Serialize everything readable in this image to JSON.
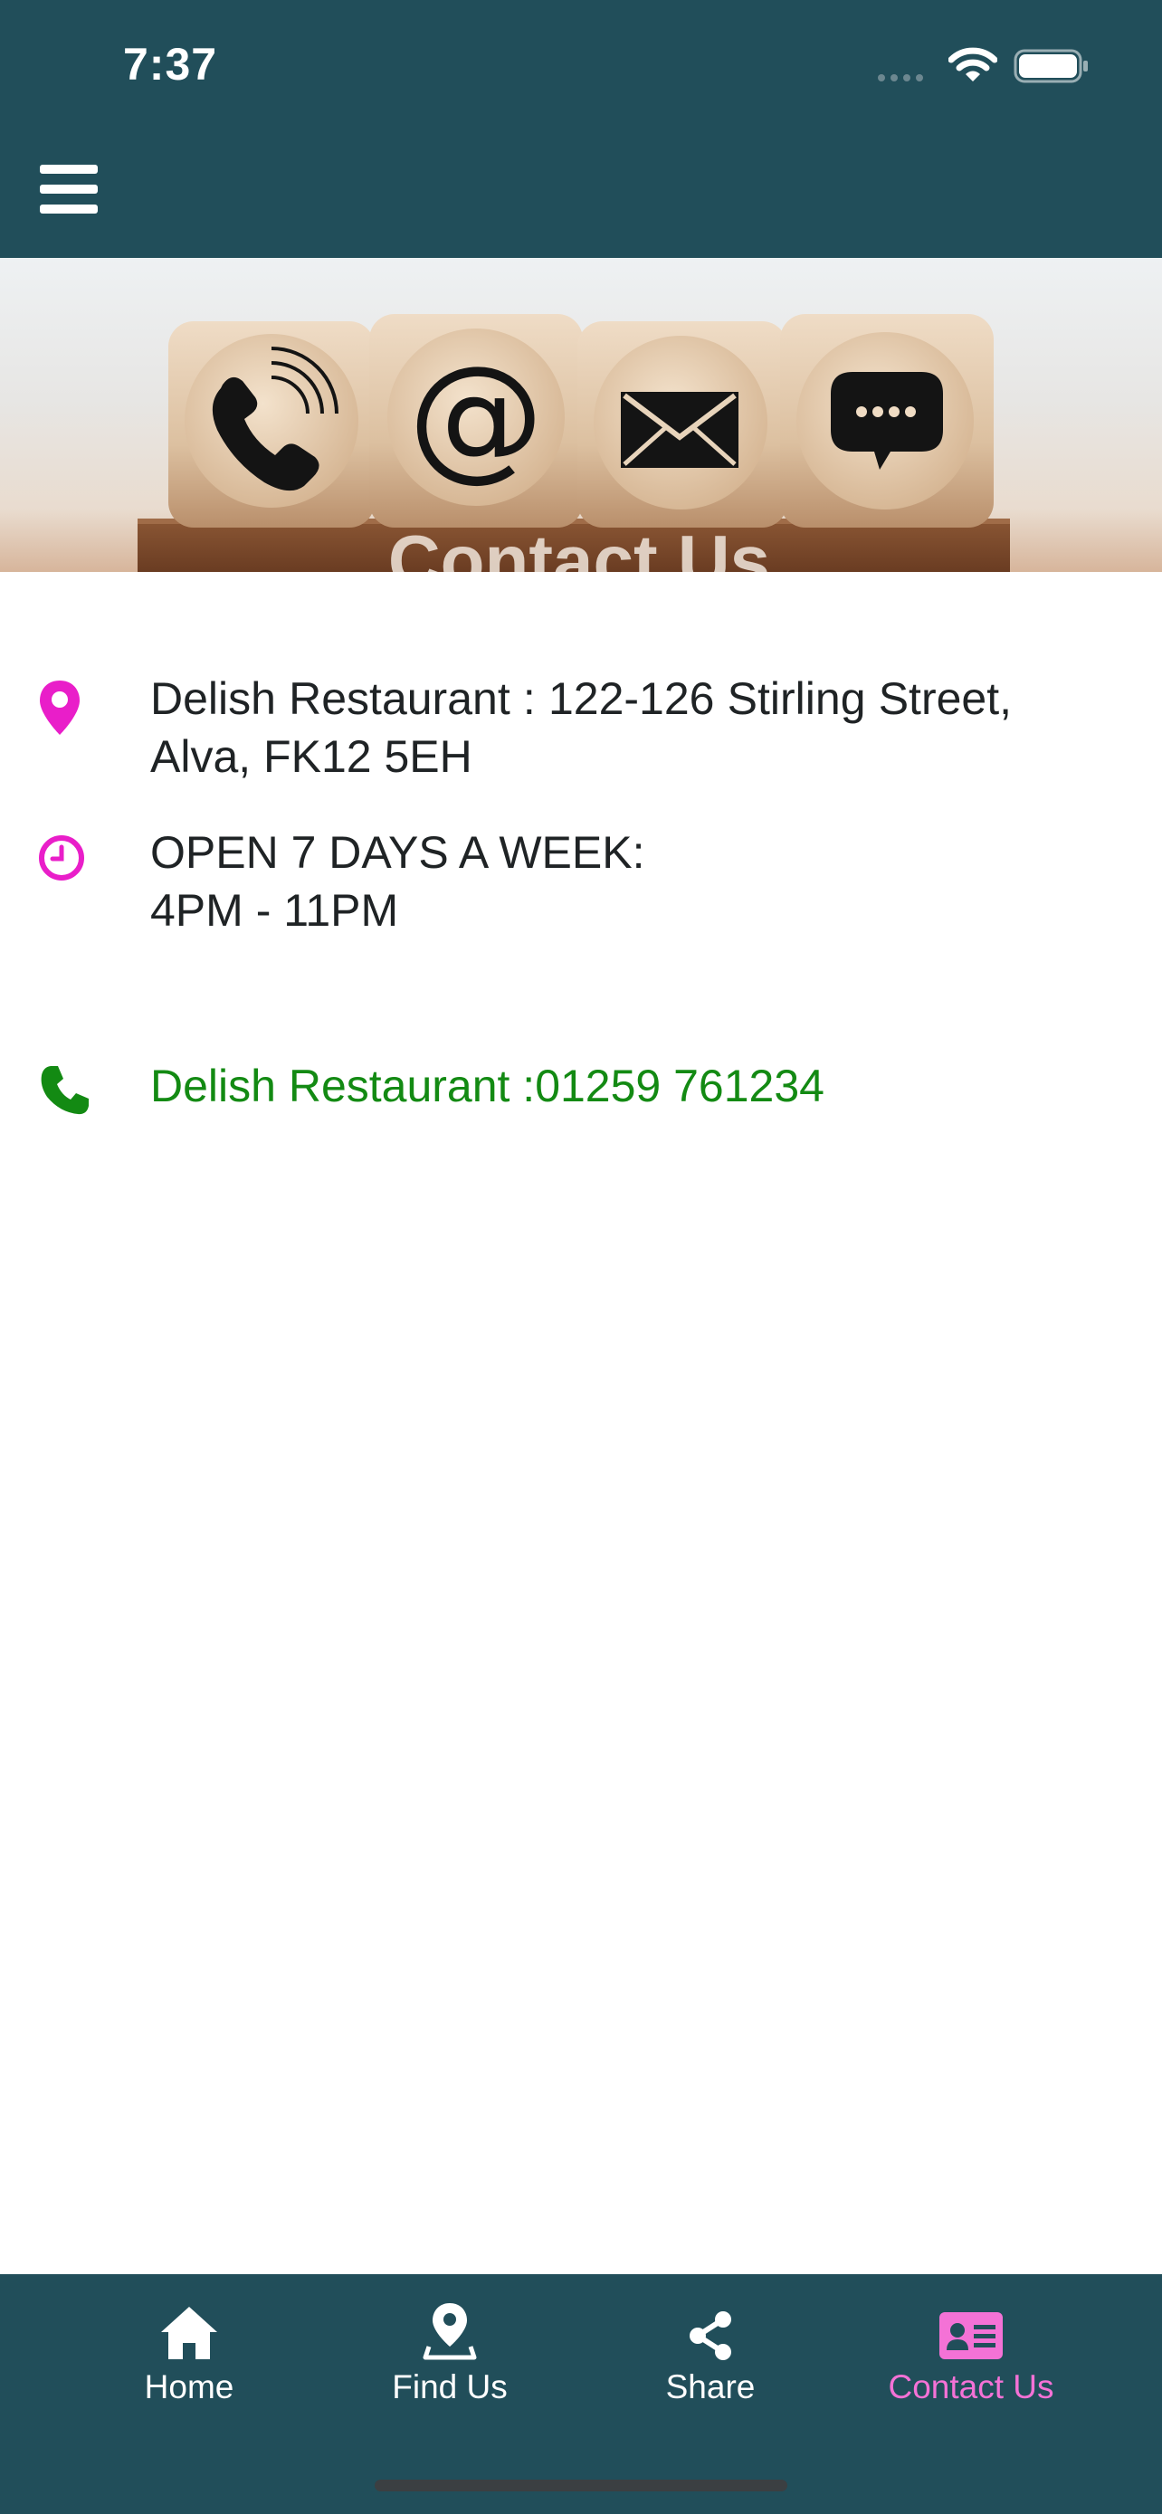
{
  "status_bar": {
    "time": "7:37",
    "icons": [
      "signal-dots-icon",
      "wifi-icon",
      "battery-icon"
    ]
  },
  "header": {
    "background_color": "#214e5a",
    "menu_icon": "hamburger-icon"
  },
  "banner": {
    "icons": [
      "phone-icon",
      "at-sign-icon",
      "envelope-icon",
      "chat-bubble-icon"
    ]
  },
  "contact": {
    "address": "Delish Restaurant : 122-126 Stirling Street, Alva, FK12 5EH",
    "hours_line1": "OPEN 7 DAYS A WEEK:",
    "hours_line2": "4PM - 11PM",
    "phone": "Delish Restaurant :01259 761234"
  },
  "colors": {
    "accent_pink": "#e91ec9",
    "phone_green": "#138a13",
    "active_tab": "#f472d6"
  },
  "tabbar": {
    "tabs": [
      {
        "label": "Home",
        "icon": "home-icon",
        "active": false
      },
      {
        "label": "Find Us",
        "icon": "map-pin-icon",
        "active": false
      },
      {
        "label": "Share",
        "icon": "share-icon",
        "active": false
      },
      {
        "label": "Contact Us",
        "icon": "contact-card-icon",
        "active": true
      }
    ]
  }
}
